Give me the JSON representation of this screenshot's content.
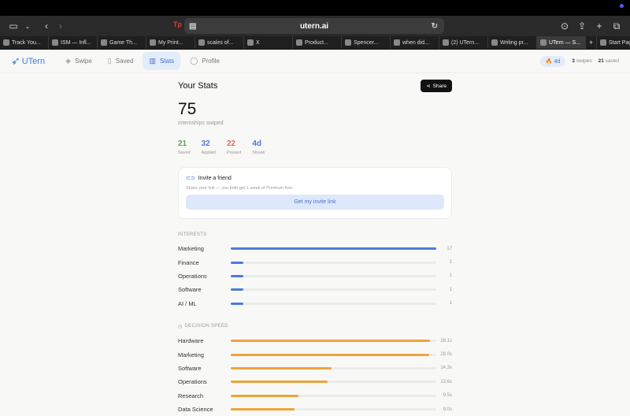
{
  "browser": {
    "url": "utern.ai",
    "tabs": [
      {
        "label": "Track You..."
      },
      {
        "label": "ISM — Infl..."
      },
      {
        "label": "Game Th..."
      },
      {
        "label": "My Print..."
      },
      {
        "label": "scales of..."
      },
      {
        "label": "X"
      },
      {
        "label": "Product..."
      },
      {
        "label": "Spencer..."
      },
      {
        "label": "when did..."
      },
      {
        "label": "(2) UTern..."
      },
      {
        "label": "Writing pr..."
      },
      {
        "label": "UTern — S..."
      },
      {
        "label": "Start Page"
      }
    ],
    "active_tab_index": 11
  },
  "nav": {
    "logo_text": "UTern",
    "items": [
      {
        "label": "Swipe",
        "icon": "layers-icon"
      },
      {
        "label": "Saved",
        "icon": "bookmark-icon"
      },
      {
        "label": "Stats",
        "icon": "bar-chart-icon"
      },
      {
        "label": "Profile",
        "icon": "person-icon"
      }
    ],
    "active_index": 2,
    "streak": "4d",
    "swipes_count": "3",
    "swipes_label": "swipes",
    "saved_count": "21",
    "saved_label": "saved"
  },
  "stats": {
    "title": "Your Stats",
    "share_label": "Share",
    "total": "75",
    "total_label": "internships swiped",
    "mini": [
      {
        "value": "21",
        "label": "Saved",
        "color": "#4caf50"
      },
      {
        "value": "32",
        "label": "Applied",
        "color": "#4a7be0"
      },
      {
        "value": "22",
        "label": "Passed",
        "color": "#e06a5a"
      },
      {
        "value": "4d",
        "label": "Streak",
        "color": "#4a7be0"
      }
    ]
  },
  "invite": {
    "title": "Invite a friend",
    "subtitle": "Share your link — you both get 1 week of Premium free.",
    "button": "Get my invite link"
  },
  "interests": {
    "title": "INTERESTS",
    "rows": [
      {
        "name": "Marketing",
        "value": "17",
        "fraction": 1.0
      },
      {
        "name": "Finance",
        "value": "1",
        "fraction": 0.06
      },
      {
        "name": "Operations",
        "value": "1",
        "fraction": 0.06
      },
      {
        "name": "Software",
        "value": "1",
        "fraction": 0.06
      },
      {
        "name": "AI / ML",
        "value": "1",
        "fraction": 0.06
      }
    ]
  },
  "speed": {
    "title": "DECISION SPEED",
    "rows": [
      {
        "name": "Hardware",
        "value": "28.1s",
        "fraction": 0.97
      },
      {
        "name": "Marketing",
        "value": "28.0s",
        "fraction": 0.965
      },
      {
        "name": "Software",
        "value": "14.3s",
        "fraction": 0.49
      },
      {
        "name": "Operations",
        "value": "13.6s",
        "fraction": 0.47
      },
      {
        "name": "Research",
        "value": "9.5s",
        "fraction": 0.33
      },
      {
        "name": "Data Science",
        "value": "9.0s",
        "fraction": 0.31
      }
    ]
  }
}
